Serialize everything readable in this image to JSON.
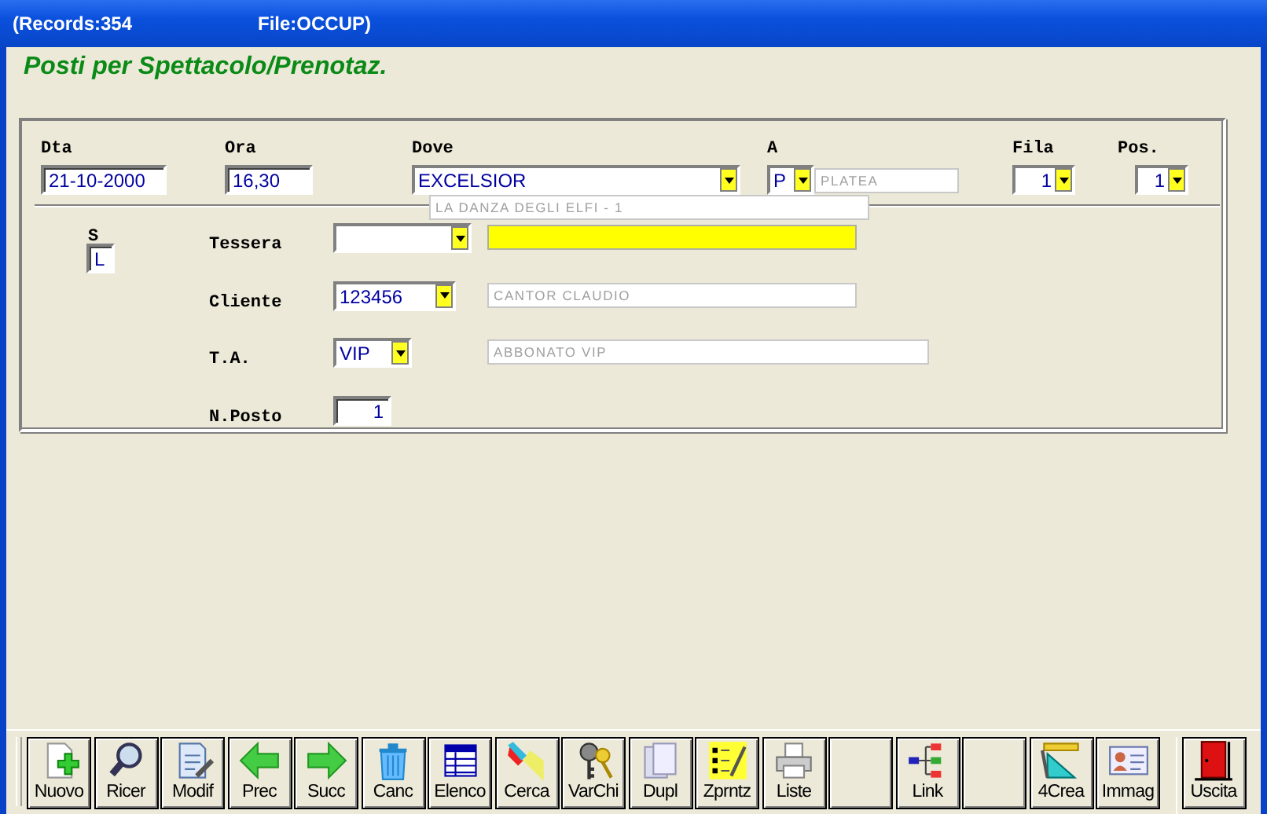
{
  "window": {
    "records": "(Records:354",
    "file": "File:OCCUP)"
  },
  "heading": "Posti per Spettacolo/Prenotaz.",
  "top_fields": [
    {
      "kind": "text",
      "label": "Dta",
      "value": "21-10-2000"
    },
    {
      "kind": "text",
      "label": "Ora",
      "value": "16,30"
    },
    {
      "kind": "combo",
      "label": "Dove",
      "value": "EXCELSIOR"
    },
    {
      "kind": "combo",
      "label": "A",
      "value": "P",
      "description": "PLATEA"
    },
    {
      "kind": "combo",
      "label": "Fila",
      "value": "1"
    },
    {
      "kind": "combo",
      "label": "Pos.",
      "value": "1"
    }
  ],
  "dove_description": "LA DANZA DEGLI ELFI - 1",
  "s_field": {
    "label": "S",
    "value": "L"
  },
  "rows": [
    {
      "kind": "combo",
      "label": "Tessera",
      "highlighted": true
    },
    {
      "kind": "combo",
      "label": "Cliente",
      "value": "123456",
      "description": "CANTOR CLAUDIO",
      "highlighted": false
    },
    {
      "kind": "combo",
      "label": "T.A.",
      "value": "VIP",
      "description": "ABBONATO VIP",
      "highlighted": false
    },
    {
      "kind": "number",
      "label": "N.Posto",
      "value": "1"
    }
  ],
  "toolbar": [
    {
      "kind": "button",
      "label": "Nuovo"
    },
    {
      "kind": "button",
      "label": "Ricer"
    },
    {
      "kind": "button",
      "label": "Modif"
    },
    {
      "kind": "button",
      "label": "Prec"
    },
    {
      "kind": "button",
      "label": "Succ"
    },
    {
      "kind": "button",
      "label": "Canc"
    },
    {
      "kind": "button",
      "label": "Elenco"
    },
    {
      "kind": "button",
      "label": "Cerca"
    },
    {
      "kind": "button",
      "label": "VarChi"
    },
    {
      "kind": "button",
      "label": "Dupl"
    },
    {
      "kind": "button",
      "label": "Zprntz"
    },
    {
      "kind": "button",
      "label": "Liste"
    },
    {
      "kind": "blank"
    },
    {
      "kind": "button",
      "label": "Link"
    },
    {
      "kind": "blank"
    },
    {
      "kind": "button",
      "label": "4Crea"
    },
    {
      "kind": "button",
      "label": "Immag"
    },
    {
      "kind": "button",
      "label": "Uscita"
    }
  ]
}
